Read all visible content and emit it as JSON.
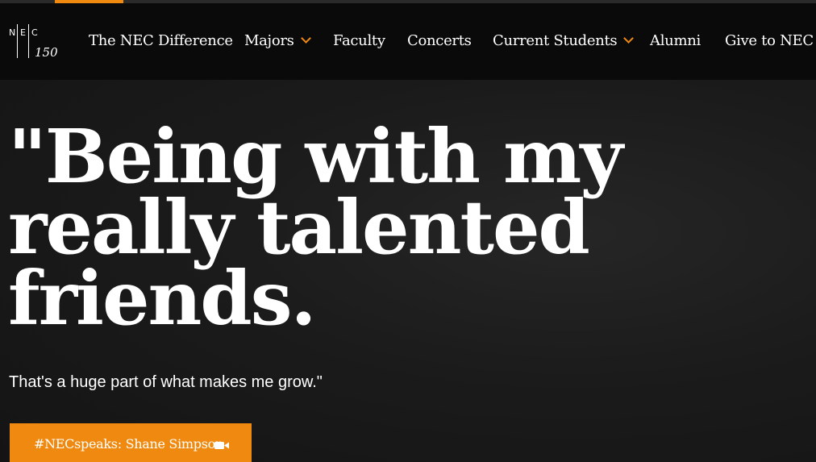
{
  "logo": {
    "letters": [
      "N",
      "E",
      "C"
    ],
    "year": "150",
    "alt": "NEC 150"
  },
  "nav": {
    "items": [
      {
        "label": "The NEC Difference",
        "has_dropdown": false
      },
      {
        "label": "Majors",
        "has_dropdown": true
      },
      {
        "label": "Faculty",
        "has_dropdown": false
      },
      {
        "label": "Concerts",
        "has_dropdown": false
      },
      {
        "label": "Current Students",
        "has_dropdown": true
      },
      {
        "label": "Alumni",
        "has_dropdown": false
      },
      {
        "label": "Give to NEC",
        "has_dropdown": true
      }
    ]
  },
  "hero": {
    "headline_lines": [
      "\"Being with my",
      "really talented",
      "friends."
    ],
    "subtext": "That's a huge part of what makes me grow.\"",
    "cta_label": "#NECspeaks: Shane Simpson",
    "cta_icon": "video-camera-icon"
  },
  "colors": {
    "accent": "#f0890f",
    "nav_background": "#0a0a0a",
    "hero_background": "#1b1b1b",
    "text": "#ffffff"
  }
}
